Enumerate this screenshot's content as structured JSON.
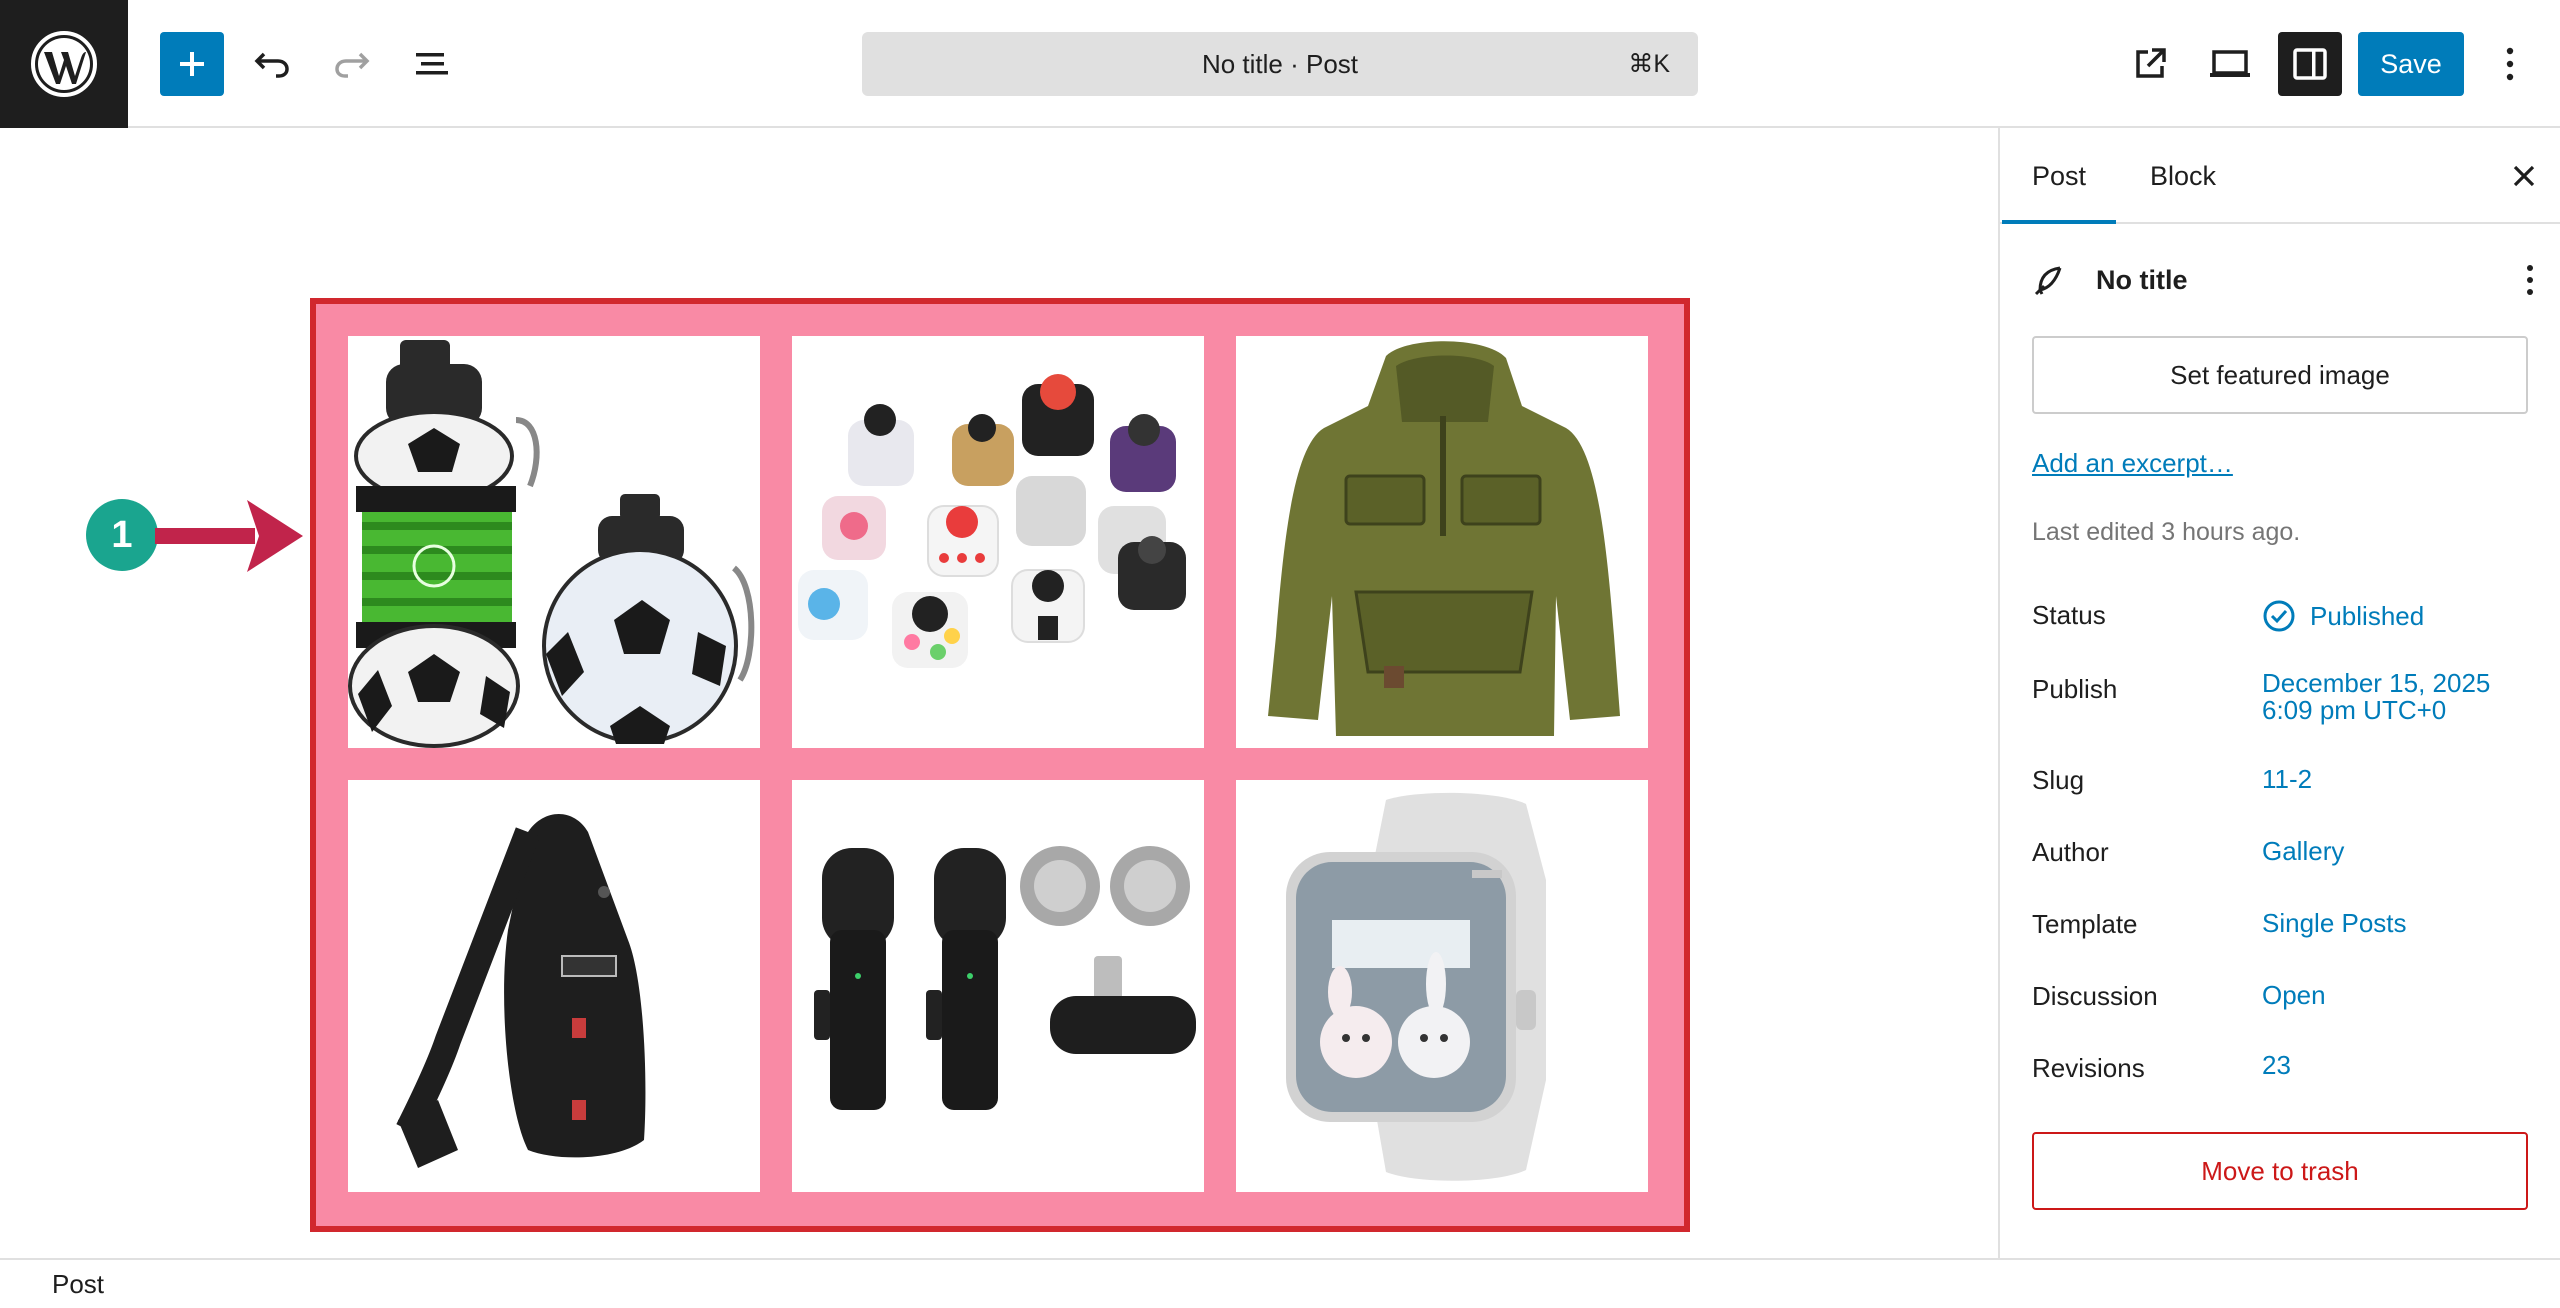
{
  "toolbar": {
    "command_title": "No title · Post",
    "command_shortcut": "⌘K",
    "save_label": "Save"
  },
  "annotation": {
    "marker_number": "1",
    "marker_color": "#1aa58f",
    "arrow_color": "#c1244b"
  },
  "gallery": {
    "background_color": "#f98aa5",
    "border_color": "#d1282e",
    "items": [
      {
        "icon": "soccer-water-bottle-image"
      },
      {
        "icon": "fidget-cubes-image"
      },
      {
        "icon": "green-hoodie-image"
      },
      {
        "icon": "black-sling-bag-image"
      },
      {
        "icon": "wireless-microphones-image"
      },
      {
        "icon": "white-smartwatch-image"
      }
    ]
  },
  "sidebar": {
    "tabs": [
      {
        "label": "Post",
        "active": true
      },
      {
        "label": "Block",
        "active": false
      }
    ],
    "post_title": "No title",
    "featured_image_label": "Set featured image",
    "excerpt_link": "Add an excerpt…",
    "last_edited": "Last edited 3 hours ago.",
    "rows": [
      {
        "label": "Status",
        "value": "Published"
      },
      {
        "label": "Publish",
        "value": "December 15, 2025",
        "value2": "6:09 pm UTC+0"
      },
      {
        "label": "Slug",
        "value": "11-2"
      },
      {
        "label": "Author",
        "value": "Gallery"
      },
      {
        "label": "Template",
        "value": "Single Posts"
      },
      {
        "label": "Discussion",
        "value": "Open"
      },
      {
        "label": "Revisions",
        "value": "23"
      }
    ],
    "trash_label": "Move to trash"
  },
  "footer": {
    "breadcrumb": "Post"
  },
  "colors": {
    "accent": "#007cba",
    "dark": "#1e1e1e",
    "danger": "#cc1818"
  }
}
